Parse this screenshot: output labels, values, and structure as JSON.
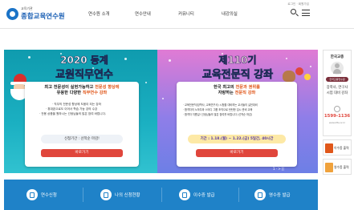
{
  "header": {
    "logo_sub": "교육기관",
    "logo_main": "종합교육연수원",
    "nav": [
      "연수원 소개",
      "연수안내",
      "커뮤니티",
      "내강의실"
    ],
    "util": "로그인 · 회원가입"
  },
  "slide1": {
    "title_small": "2020 동계",
    "title_big": "교원직무연수",
    "head_line1": "최고 전문성이 실현가능하고 ",
    "head_hl1": "전문성 향상에",
    "head_line2": "유용한 다양한 ",
    "head_hl2": "직무연수 강좌",
    "bullets": [
      "· 직무의 전문성 향상에 도움이 되는 강좌",
      "· 휴대폰으로도 이어서 학습 가능 강의 수강",
      "· 전용 상품을 원하시는 선생님들의 많은 참여 바랍니다."
    ],
    "pill": "신청기간 : 선착순 마감!",
    "button": "바로가기"
  },
  "slide2": {
    "title_small": "제110기",
    "title_big": "교육전문직 강좌",
    "head_line1": "한국 최고의 ",
    "head_hl1": "전문과 권위를",
    "head_line2": "자랑하는 ",
    "head_hl2": "전문직 강좌",
    "bullets": [
      "· 교육전문직(장학사, 교육연구사) 시험을 대비하는 교사들의 실전대비",
      "· 합격자의 노하우와 스터디 그룹 조직으로 탄탄한 입시 준비 교육",
      "· 합격자 지름길! 선생님들의 많은 참여를 바랍니다 (선착순 마감)"
    ],
    "pill": "기간 : 1.18.(월) ~ 1.22.(금)  5일간, 40시간",
    "button": "바로가기",
    "controls": "1  ·  >  ||"
  },
  "sidebar": {
    "title": "한국교총",
    "badge": "한국교총연수원",
    "text1": "장학사, 연구사",
    "text2": "시험 대비 강좌",
    "phone": "1599-1136",
    "url": "www.kfta.or.kr",
    "btn1": "이수증 출력",
    "btn2": "영수증 출력"
  },
  "quick_links": [
    "연수신청",
    "나의 신청현황",
    "이수증 발급",
    "영수증 발급"
  ]
}
